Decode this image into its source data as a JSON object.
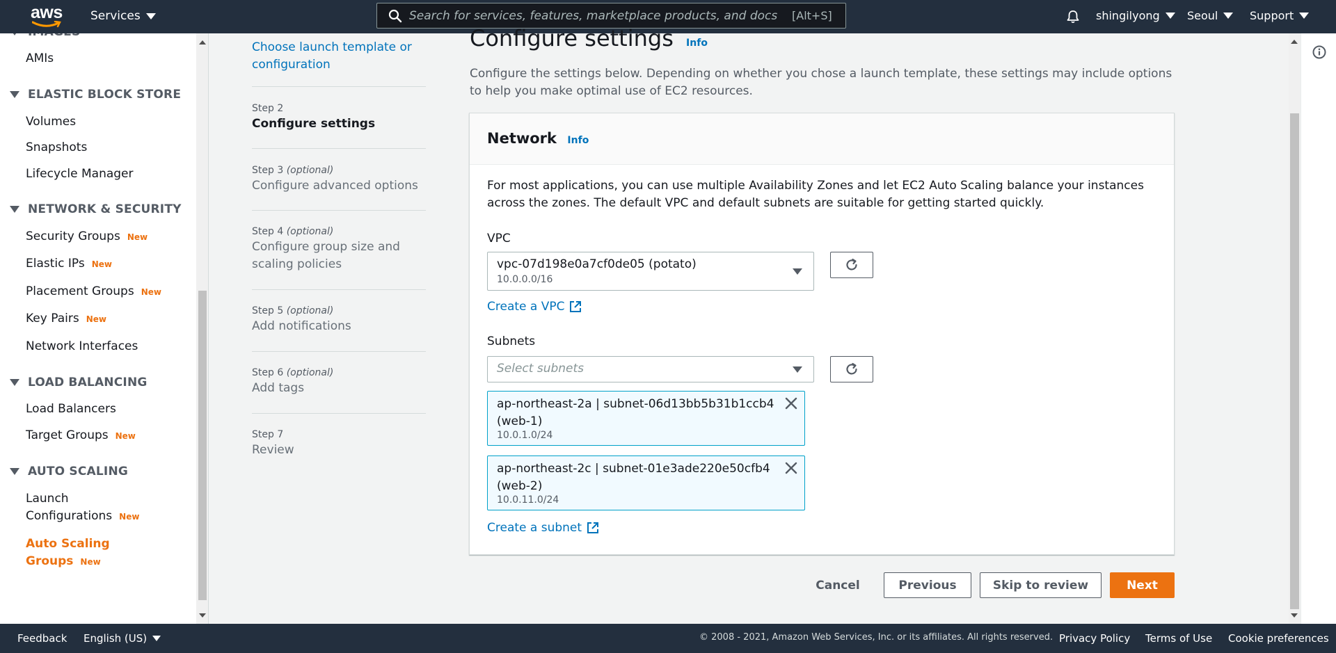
{
  "topnav": {
    "logo_text": "aws",
    "services_label": "Services",
    "search_placeholder": "Search for services, features, marketplace products, and docs",
    "search_shortcut": "[Alt+S]",
    "user": "shingilyong",
    "region": "Seoul",
    "support": "Support"
  },
  "sidebar": {
    "partial_category": "IMAGES",
    "items_top": [
      "AMIs"
    ],
    "categories": {
      "ebs": "ELASTIC BLOCK STORE",
      "netsec": "NETWORK & SECURITY",
      "lb": "LOAD BALANCING",
      "as": "AUTO SCALING"
    },
    "ebs_items": [
      "Volumes",
      "Snapshots",
      "Lifecycle Manager"
    ],
    "netsec_items": [
      "Security Groups",
      "Elastic IPs",
      "Placement Groups",
      "Key Pairs",
      "Network Interfaces"
    ],
    "lb_items": [
      "Load Balancers",
      "Target Groups"
    ],
    "as_items": [
      "Launch Configurations",
      "Auto Scaling Groups"
    ],
    "new_badge": "New"
  },
  "steps": {
    "step1_title": "Choose launch template or configuration",
    "step2_label": "Step 2",
    "step2_title": "Configure settings",
    "step3_label": "Step 3",
    "step3_title": "Configure advanced options",
    "step4_label": "Step 4",
    "step4_title": "Configure group size and scaling policies",
    "step5_label": "Step 5",
    "step5_title": "Add notifications",
    "step6_label": "Step 6",
    "step6_title": "Add tags",
    "step7_label": "Step 7",
    "step7_title": "Review",
    "optional": "(optional)"
  },
  "main": {
    "title": "Configure settings",
    "info": "Info",
    "description": "Configure the settings below. Depending on whether you chose a launch template, these settings may include options to help you make optimal use of EC2 resources."
  },
  "network": {
    "heading": "Network",
    "info": "Info",
    "description": "For most applications, you can use multiple Availability Zones and let EC2 Auto Scaling balance your instances across the zones. The default VPC and default subnets are suitable for getting started quickly.",
    "vpc_label": "VPC",
    "vpc_value": "vpc-07d198e0a7cf0de05 (potato)",
    "vpc_cidr": "10.0.0.0/16",
    "create_vpc": "Create a VPC",
    "subnets_label": "Subnets",
    "subnets_placeholder": "Select subnets",
    "subnets": [
      {
        "name": "ap-northeast-2a | subnet-06d13bb5b31b1ccb4 (web-1)",
        "cidr": "10.0.1.0/24"
      },
      {
        "name": "ap-northeast-2c | subnet-01e3ade220e50cfb4 (web-2)",
        "cidr": "10.0.11.0/24"
      }
    ],
    "create_subnet": "Create a subnet"
  },
  "actions": {
    "cancel": "Cancel",
    "previous": "Previous",
    "skip": "Skip to review",
    "next": "Next"
  },
  "footer": {
    "feedback": "Feedback",
    "language": "English (US)",
    "copyright": "© 2008 - 2021, Amazon Web Services, Inc. or its affiliates. All rights reserved.",
    "privacy": "Privacy Policy",
    "terms": "Terms of Use",
    "cookies": "Cookie preferences"
  },
  "colors": {
    "nav_bg": "#232f3e",
    "accent": "#ec7211",
    "link": "#0073bb"
  }
}
